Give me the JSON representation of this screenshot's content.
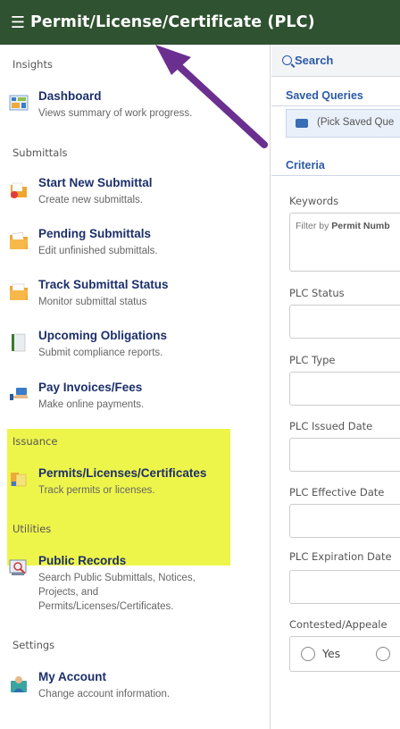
{
  "app": {
    "title": "Permit/License/Certificate (PLC)",
    "menu_icon": "hamburger-icon"
  },
  "sidebar": {
    "sections": {
      "insights": "Insights",
      "submittals": "Submittals",
      "issuance": "Issuance",
      "utilities": "Utilities",
      "settings": "Settings"
    },
    "items": {
      "dashboard": {
        "label": "Dashboard",
        "desc": "Views summary of work progress.",
        "icon": "dashboard-icon"
      },
      "start_new": {
        "label": "Start New Submittal",
        "desc": "Create new submittals.",
        "icon": "new-submittal-icon"
      },
      "pending": {
        "label": "Pending Submittals",
        "desc": "Edit unfinished submittals.",
        "icon": "pending-folder-icon"
      },
      "track": {
        "label": "Track Submittal Status",
        "desc": "Monitor submittal status",
        "icon": "track-folder-icon"
      },
      "upcoming": {
        "label": "Upcoming Obligations",
        "desc": "Submit compliance reports.",
        "icon": "obligations-book-icon"
      },
      "pay": {
        "label": "Pay Invoices/Fees",
        "desc": "Make online payments.",
        "icon": "payment-hand-icon"
      },
      "permits": {
        "label": "Permits/Licenses/Certificates",
        "desc": "Track permits or licenses.",
        "icon": "permits-icon"
      },
      "public_records": {
        "label": "Public Records",
        "desc": "Search Public Submittals, Notices, Projects, and Permits/Licenses/Certificates.",
        "icon": "public-records-icon"
      },
      "my_account": {
        "label": "My Account",
        "desc": "Change account information.",
        "icon": "account-icon"
      }
    },
    "highlight_color": "#eef54a"
  },
  "panel": {
    "search_label": "Search",
    "saved_queries_title": "Saved Queries",
    "saved_queries_value": "(Pick Saved Que",
    "criteria_title": "Criteria",
    "keywords_label": "Keywords",
    "keywords_placeholder_prefix": "Filter by ",
    "keywords_placeholder_bold": "Permit Numb",
    "status_label": "PLC Status",
    "type_label": "PLC Type",
    "issued_date_label": "PLC Issued Date",
    "effective_date_label": "PLC Effective Date",
    "expiration_date_label": "PLC Expiration Date",
    "contested_label": "Contested/Appeale",
    "radio_yes": "Yes"
  },
  "colors": {
    "titlebar": "#2f5230",
    "link": "#1c2f6b",
    "accent": "#2c5aa6",
    "arrow": "#6a2f8f"
  }
}
